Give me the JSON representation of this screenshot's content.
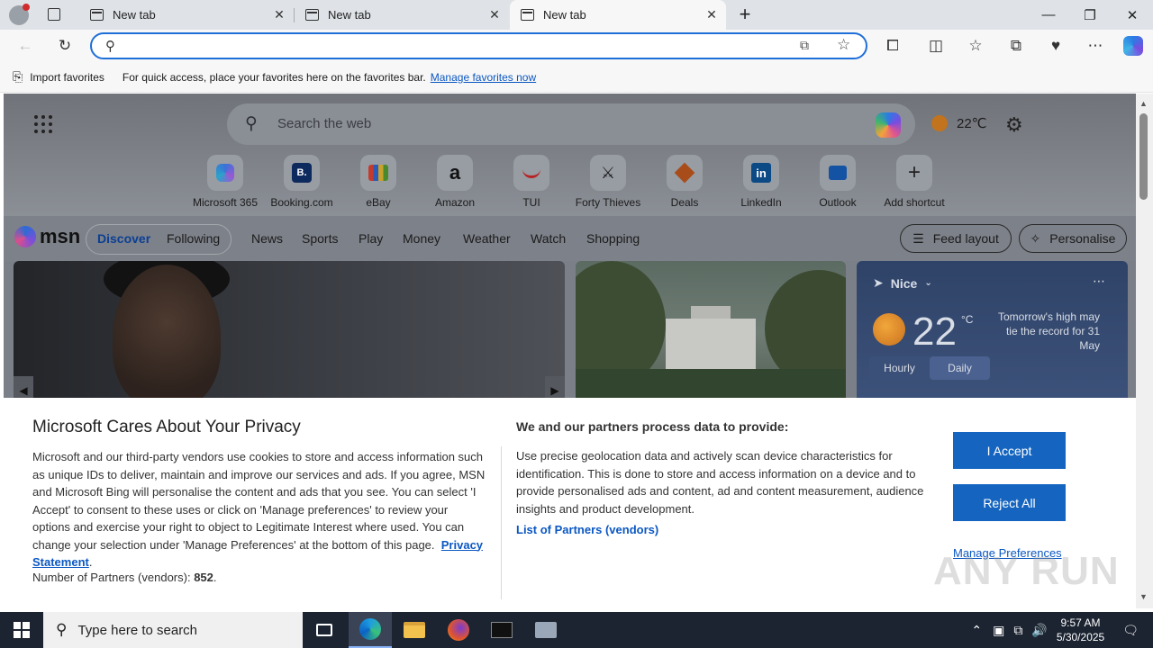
{
  "browser": {
    "tabs": [
      {
        "title": "New tab"
      },
      {
        "title": "New tab"
      },
      {
        "title": "New tab"
      }
    ],
    "address_placeholder": "",
    "favorites_bar": {
      "import_label": "Import favorites",
      "message": "For quick access, place your favorites here on the favorites bar.",
      "manage_link": "Manage favorites now"
    }
  },
  "newtab": {
    "search_placeholder": "Search the web",
    "weather_top": "22℃",
    "tiles": [
      {
        "label": "Microsoft 365",
        "icon": "m365-icon",
        "glyph": ""
      },
      {
        "label": "Booking.com",
        "icon": "booking-icon",
        "glyph": "B."
      },
      {
        "label": "eBay",
        "icon": "ebay-icon",
        "glyph": ""
      },
      {
        "label": "Amazon",
        "icon": "amazon-icon",
        "glyph": "a"
      },
      {
        "label": "TUI",
        "icon": "tui-icon",
        "glyph": ""
      },
      {
        "label": "Forty Thieves",
        "icon": "forty-thieves-icon",
        "glyph": ""
      },
      {
        "label": "Deals",
        "icon": "deals-icon",
        "glyph": ""
      },
      {
        "label": "LinkedIn",
        "icon": "linkedin-icon",
        "glyph": "in"
      },
      {
        "label": "Outlook",
        "icon": "outlook-icon",
        "glyph": ""
      },
      {
        "label": "Add shortcut",
        "icon": "plus-icon",
        "glyph": "+"
      }
    ],
    "msn": {
      "logo": "msn",
      "nav": [
        "Discover",
        "Following",
        "News",
        "Sports",
        "Play",
        "Money",
        "Weather",
        "Watch",
        "Shopping"
      ],
      "feed_layout": "Feed layout",
      "personalise": "Personalise"
    },
    "weather_card": {
      "location": "Nice",
      "temp": "22",
      "unit": "°C",
      "note": "Tomorrow's high may tie the record for 31 May",
      "tabs": [
        "Hourly",
        "Daily"
      ]
    }
  },
  "privacy": {
    "title": "Microsoft Cares About Your Privacy",
    "body": "Microsoft and our third-party vendors use cookies to store and access information such as unique IDs to deliver, maintain and improve our services and ads. If you agree, MSN and Microsoft Bing will personalise the content and ads that you see. You can select 'I Accept' to consent to these uses or click on 'Manage preferences' to review your options and exercise your right to object to Legitimate Interest where used.  You can change your selection under 'Manage Preferences' at the bottom of this page.",
    "privacy_link": "Privacy Statement",
    "partners_count_label": "Number of Partners (vendors):",
    "partners_count": "852",
    "heading2": "We and our partners process data to provide:",
    "body2": "Use precise geolocation data and actively scan device characteristics for identification. This is done to store and access information on a device and to provide personalised ads and content, ad and content measurement, audience insights and product development.",
    "partners_link": "List of Partners (vendors)",
    "accept": "I Accept",
    "reject": "Reject All",
    "manage": "Manage Preferences"
  },
  "watermark": "ANY RUN",
  "taskbar": {
    "search_placeholder": "Type here to search",
    "time": "9:57 AM",
    "date": "5/30/2025"
  }
}
